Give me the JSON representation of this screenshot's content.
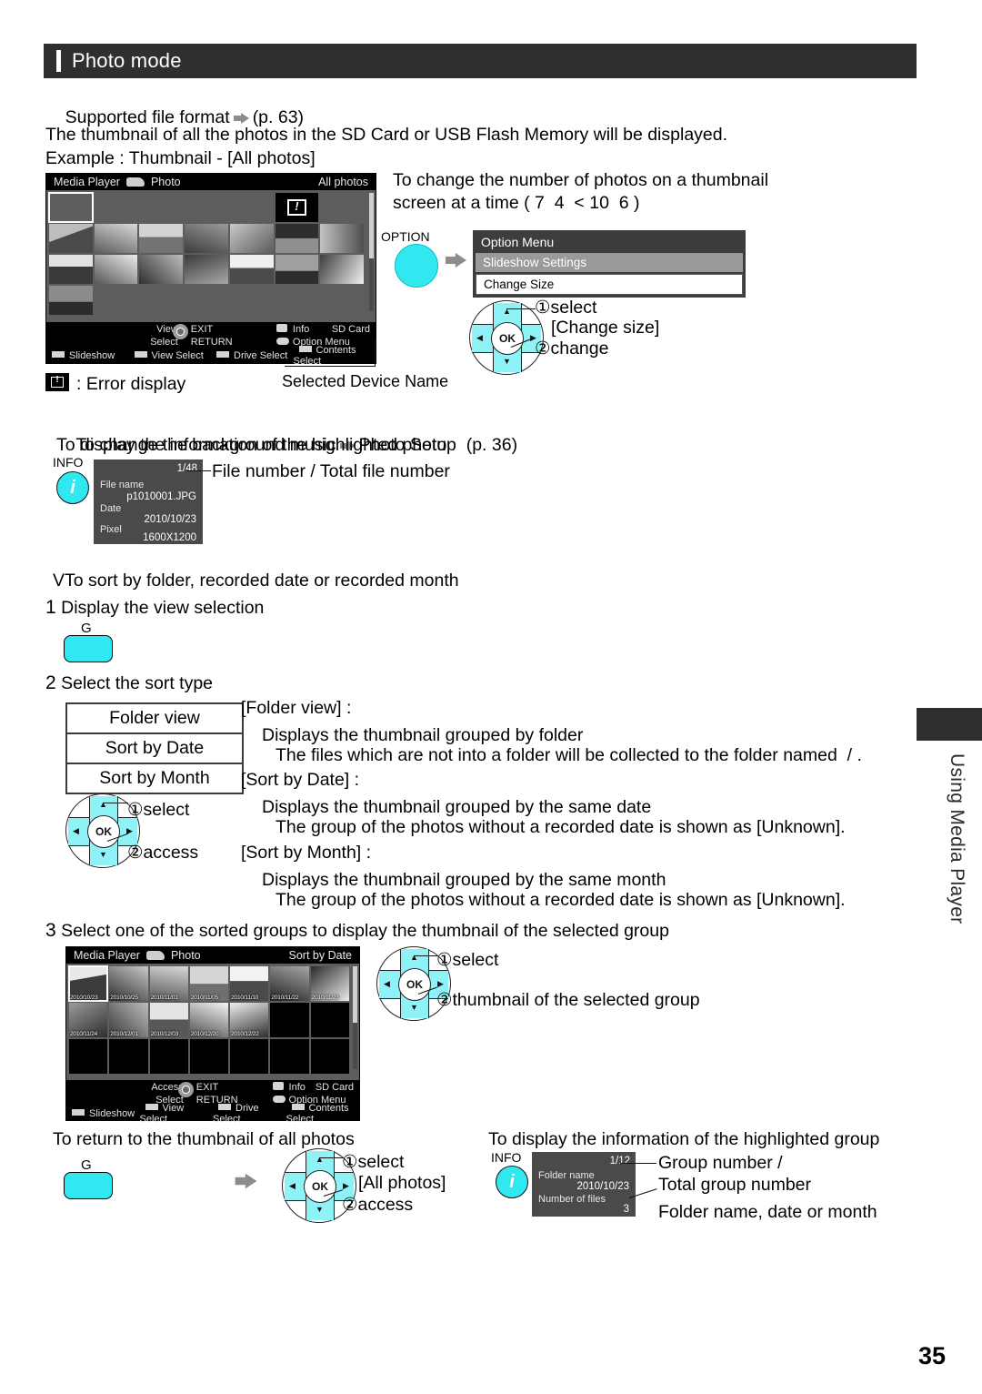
{
  "section": {
    "title": "Photo mode"
  },
  "intro": {
    "supported_format": "Supported file format",
    "supported_format_ref": "(p. 63)",
    "description": "The thumbnail of all the photos in the SD Card or USB Flash Memory will be displayed.",
    "example": "Example : Thumbnail - [All photos]"
  },
  "screen1": {
    "app_title": "Media Player",
    "mode": "Photo",
    "view_label": "All photos",
    "device": "SD Card",
    "footer": {
      "row1_left": "View",
      "row1_mid": "EXIT",
      "row1_info": "Info",
      "row2_left": "Select",
      "row2_mid": "RETURN",
      "row2_info": "Option Menu",
      "color_keys": [
        "Slideshow",
        "View Select",
        "Drive Select",
        "Contents Select"
      ]
    },
    "error_legend": ": Error display",
    "device_caption": "Selected Device Name"
  },
  "change_size": {
    "heading_line1": "To change the number of photos on a thumbnail",
    "heading_line2": "screen at a time ( 7  4  < 10  6 )",
    "option_button_label": "OPTION",
    "option_menu": {
      "title": "Option Menu",
      "items": [
        "Slideshow Settings",
        "Change Size"
      ]
    },
    "step1": "select",
    "step1_target": "[Change size]",
    "step2": "change"
  },
  "bgm": {
    "line": "To change the background music",
    "target": "Photo Setup",
    "ref": "(p. 36)"
  },
  "photo_info": {
    "heading": "To display the information of the highlighted photo",
    "info_button_label": "INFO",
    "counter": "1/48",
    "callout": "File number / Total file number",
    "rows": [
      {
        "label": "File name",
        "value": "p1010001.JPG"
      },
      {
        "label": "Date",
        "value": "2010/10/23"
      },
      {
        "label": "Pixel",
        "value": "1600X1200"
      }
    ]
  },
  "sort": {
    "heading_bullet": "V",
    "heading": "To sort by folder, recorded date or recorded month",
    "step1_num": "1",
    "step1_text": "Display the view selection",
    "key_label": "G",
    "step2_num": "2",
    "step2_text": "Select the sort type",
    "options": [
      "Folder view",
      "Sort by Date",
      "Sort by Month"
    ],
    "dpad_step1": "select",
    "dpad_step2": "access",
    "descriptions": [
      {
        "title": "[Folder view] :",
        "line1": "Displays the thumbnail grouped by folder",
        "line2": "The files which are not into a folder will be collected to the folder named  / ."
      },
      {
        "title": "[Sort by Date] :",
        "line1": "Displays the thumbnail grouped by the same date",
        "line2": "The group of the photos without a recorded date is shown as [Unknown]."
      },
      {
        "title": "[Sort by Month] :",
        "line1": "Displays the thumbnail grouped by the same month",
        "line2": "The group of the photos without a recorded date is shown as [Unknown]."
      }
    ]
  },
  "step3": {
    "num": "3",
    "text": "Select one of the sorted groups to display the thumbnail of the selected group",
    "dpad_step1": "select",
    "dpad_step2": "thumbnail of the selected group"
  },
  "screen2": {
    "app_title": "Media Player",
    "mode": "Photo",
    "view_label": "Sort by Date",
    "device": "SD Card",
    "group_dates": [
      "2010/10/23",
      "2010/10/25",
      "2010/11/01",
      "2010/11/05",
      "2010/11/10",
      "2010/11/22",
      "2010/11/23",
      "2010/11/24",
      "2010/12/01",
      "2010/12/03",
      "2010/12/20",
      "2010/12/22"
    ],
    "footer": {
      "row1_left": "Access",
      "row1_mid": "EXIT",
      "row1_info": "Info",
      "row2_left": "Select",
      "row2_mid": "RETURN",
      "row2_info": "Option Menu",
      "color_keys": [
        "Slideshow",
        "View Select",
        "Drive Select",
        "Contents Select"
      ]
    }
  },
  "return_all": {
    "heading": "To return to the thumbnail of all photos",
    "key_label": "G",
    "step1": "select",
    "step1_target": "[All photos]",
    "step2": "access"
  },
  "group_info": {
    "heading": "To display the information of the highlighted group",
    "info_button_label": "INFO",
    "counter": "1/12",
    "callout1_line1": "Group number /",
    "callout1_line2": "Total group number",
    "callout2": "Folder name, date or month",
    "rows": [
      {
        "label": "Folder name",
        "value": "2010/10/23"
      },
      {
        "label": "Number of files",
        "value": "3"
      }
    ]
  },
  "side_tab": {
    "label": "Using Media Player"
  },
  "footer": {
    "page_number": "35"
  },
  "colors": {
    "title_bar": "#2f2f2f",
    "cyan_button": "#31e8f0",
    "tv_background": "#5d5d5d",
    "menu_highlight": "#9a9a9a"
  }
}
